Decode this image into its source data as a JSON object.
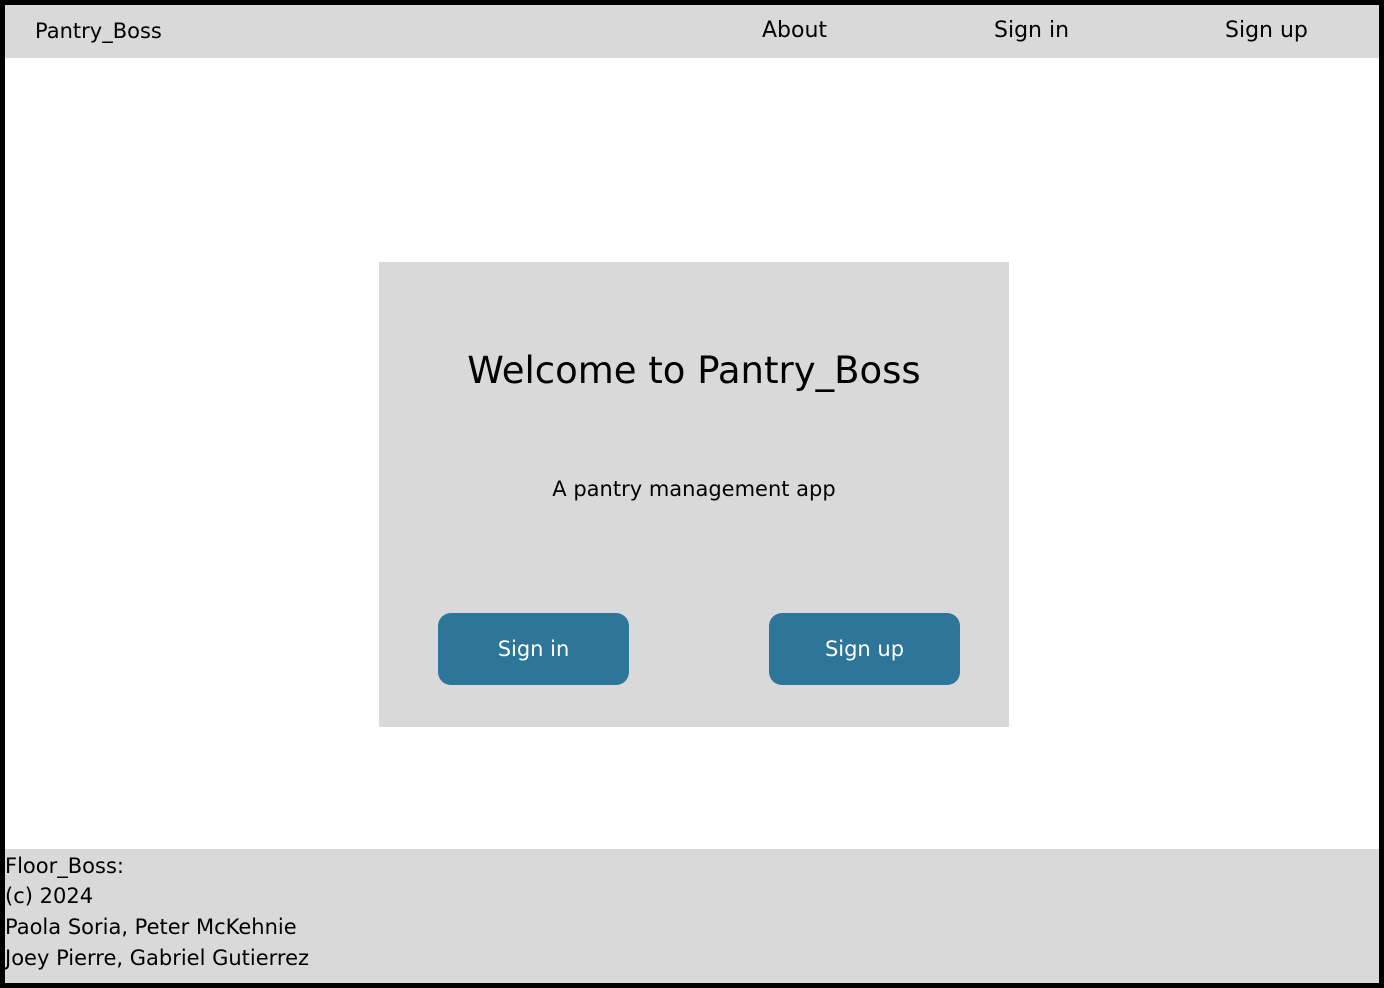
{
  "navbar": {
    "brand": "Pantry_Boss",
    "links": [
      {
        "label": "About"
      },
      {
        "label": "Sign in"
      },
      {
        "label": "Sign up"
      }
    ]
  },
  "welcome": {
    "title": "Welcome to Pantry_Boss",
    "subtitle": "A pantry management app",
    "buttons": {
      "sign_in": "Sign in",
      "sign_up": "Sign up"
    }
  },
  "footer": {
    "lines": [
      "Floor_Boss:",
      "(c) 2024",
      "Paola Soria, Peter McKehnie",
      "Joey Pierre, Gabriel Gutierrez"
    ]
  },
  "colors": {
    "panel_gray": "#d9d9d9",
    "button_blue": "#2e7699",
    "border_black": "#000000"
  }
}
